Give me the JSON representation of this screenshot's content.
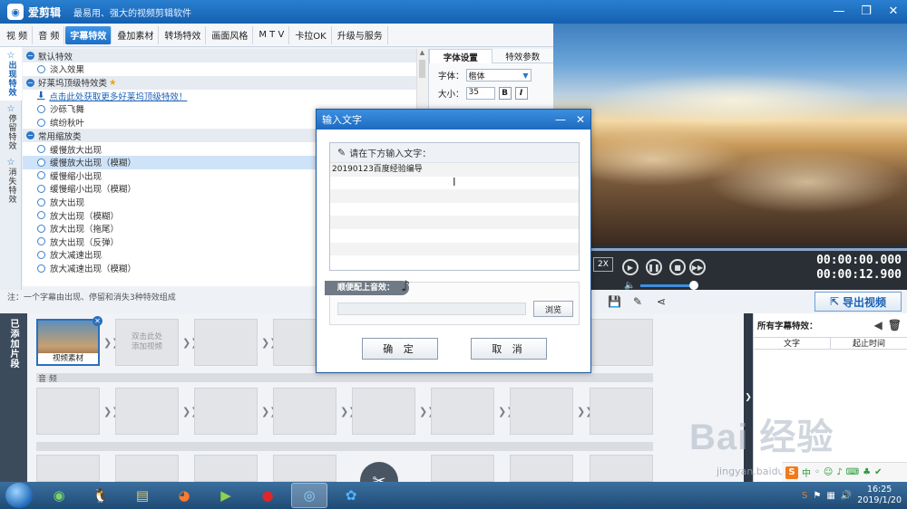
{
  "app": {
    "name": "爱剪辑",
    "slogan": "最易用、强大的视频剪辑软件"
  },
  "main_tabs": [
    {
      "label": "视 频",
      "active": false
    },
    {
      "label": "音 频",
      "active": false
    },
    {
      "label": "字幕特效",
      "active": true
    },
    {
      "label": "叠加素材",
      "active": false
    },
    {
      "label": "转场特效",
      "active": false
    },
    {
      "label": "画面风格",
      "active": false
    },
    {
      "label": "M T V",
      "active": false
    },
    {
      "label": "卡拉OK",
      "active": false
    },
    {
      "label": "升级与服务",
      "active": false
    }
  ],
  "rail_tabs": [
    {
      "label": "出现特效",
      "active": true
    },
    {
      "label": "停留特效",
      "active": false
    },
    {
      "label": "消失特效",
      "active": false
    }
  ],
  "effect_groups": {
    "default": {
      "header": "默认特效",
      "items": [
        "淡入效果"
      ]
    },
    "hollywood": {
      "header": "好莱坞顶级特效类",
      "link": "点击此处获取更多好莱坞顶级特效！",
      "items": [
        "沙砾飞舞",
        "缤纷秋叶"
      ]
    },
    "zoom": {
      "header": "常用缩放类",
      "items": [
        "缓慢放大出现",
        "缓慢放大出现（模糊）",
        "缓慢缩小出现",
        "缓慢缩小出现（模糊）",
        "放大出现",
        "放大出现（模糊）",
        "放大出现（拖尾）",
        "放大出现（反弹）",
        "放大减速出现",
        "放大减速出现（模糊）"
      ],
      "selected_index": 1
    }
  },
  "font_panel": {
    "tabs": [
      "字体设置",
      "特效参数"
    ],
    "font_label": "字体：",
    "font_value": "楷体",
    "size_label": "大小：",
    "size_value": "35",
    "bold": "B",
    "italic": "I"
  },
  "note": "注：一个字幕由出现、停留和消失3种特效组成",
  "player": {
    "speed": "2X",
    "time_current": "00:00:00.000",
    "time_total": "00:00:12.900"
  },
  "export_label": "导出视频",
  "timeline": {
    "side_label": "已添加片段",
    "clip_label": "视频素材",
    "add_hint": "双击此处\n添加视频",
    "audio_label": "音 频"
  },
  "subtitle_panel": {
    "title": "所有字幕特效：",
    "col_text": "文字",
    "col_time": "起止时间"
  },
  "dialog": {
    "title": "输入文字",
    "prompt": "请在下方输入文字：",
    "text": "20190123百度经验编导",
    "audio_label": "顺便配上音效：",
    "browse": "浏览",
    "ok": "确 定",
    "cancel": "取 消"
  },
  "watermark": {
    "logo": "Bai 经验",
    "url": "jingyan.baidu.com"
  },
  "taskbar": {
    "time": "16:25",
    "date": "2019/1/20"
  },
  "colors": {
    "accent": "#1e6ac0",
    "title_bar": "#1560b0"
  }
}
